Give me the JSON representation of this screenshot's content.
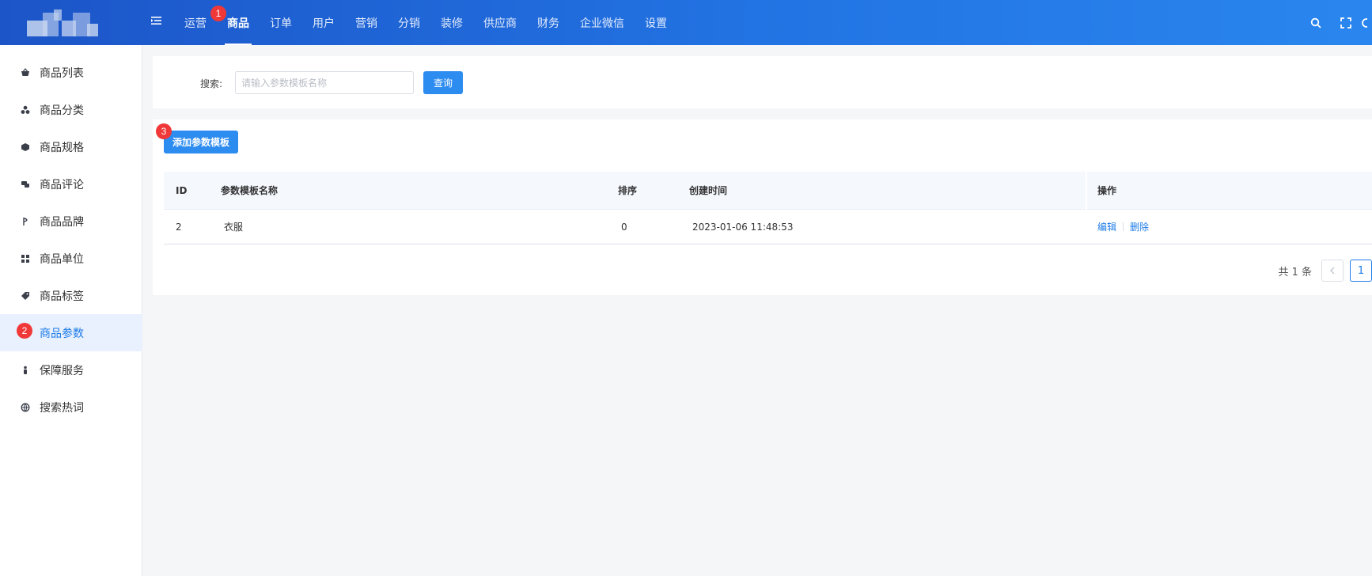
{
  "topbar": {
    "nav": [
      {
        "label": "运营"
      },
      {
        "label": "商品"
      },
      {
        "label": "订单"
      },
      {
        "label": "用户"
      },
      {
        "label": "营销"
      },
      {
        "label": "分销"
      },
      {
        "label": "装修"
      },
      {
        "label": "供应商"
      },
      {
        "label": "财务"
      },
      {
        "label": "企业微信"
      },
      {
        "label": "设置"
      }
    ],
    "active_index": 1,
    "icons": [
      "menu-fold-icon",
      "search-icon",
      "fullscreen-icon"
    ]
  },
  "annotations": {
    "b1": "1",
    "b2": "2",
    "b3": "3"
  },
  "sidebar": {
    "items": [
      {
        "label": "商品列表",
        "icon": "basket-icon"
      },
      {
        "label": "商品分类",
        "icon": "category-icon"
      },
      {
        "label": "商品规格",
        "icon": "cube-icon"
      },
      {
        "label": "商品评论",
        "icon": "comment-icon"
      },
      {
        "label": "商品品牌",
        "icon": "brand-icon"
      },
      {
        "label": "商品单位",
        "icon": "grid-icon"
      },
      {
        "label": "商品标签",
        "icon": "tag-icon"
      },
      {
        "label": "商品参数",
        "icon": "params-icon"
      },
      {
        "label": "保障服务",
        "icon": "person-icon"
      },
      {
        "label": "搜索热词",
        "icon": "globe-icon"
      }
    ],
    "active_index": 7
  },
  "search": {
    "label": "搜索:",
    "placeholder": "请输入参数模板名称",
    "value": "",
    "query_label": "查询"
  },
  "list": {
    "add_label": "添加参数模板",
    "columns": {
      "id": "ID",
      "name": "参数模板名称",
      "sort": "排序",
      "created": "创建时间",
      "actions": "操作"
    },
    "rows": [
      {
        "id": "2",
        "name": "衣服",
        "sort": "0",
        "created": "2023-01-06 11:48:53",
        "edit": "编辑",
        "delete": "删除"
      }
    ]
  },
  "pagination": {
    "total": "共 1 条",
    "current": "1"
  },
  "colors": {
    "brand": "#1f7ce8",
    "badge": "#f03838",
    "topbar_from": "#1c55c8",
    "topbar_to": "#2a86ee"
  }
}
